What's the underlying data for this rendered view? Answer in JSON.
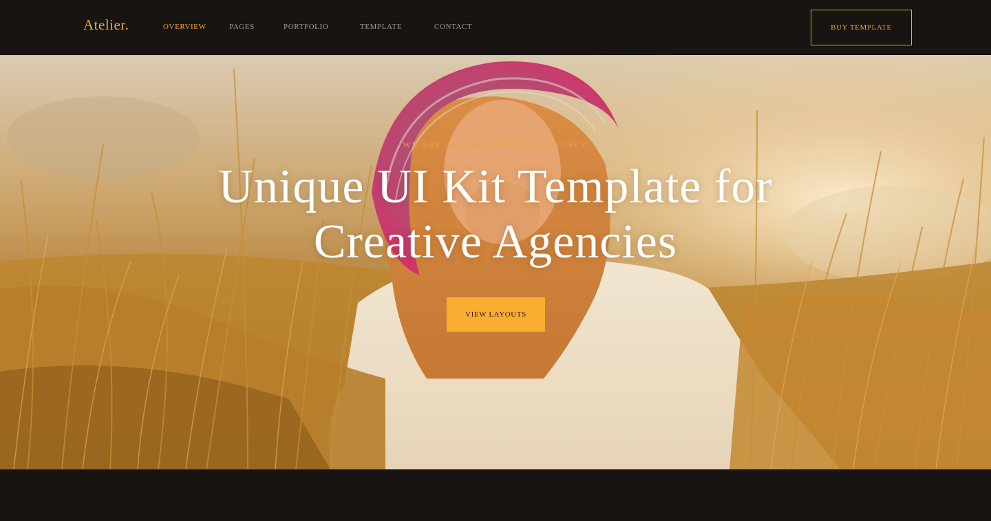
{
  "brand": {
    "logo": "Atelier."
  },
  "nav": {
    "items": [
      {
        "label": "OVERVIEW",
        "active": true
      },
      {
        "label": "PAGES",
        "active": false
      },
      {
        "label": "PORTFOLIO",
        "active": false
      },
      {
        "label": "TEMPLATE",
        "active": false
      },
      {
        "label": "CONTACT",
        "active": false
      }
    ],
    "cta_label": "BUY TEMPLATE"
  },
  "hero": {
    "eyebrow": "WE ARE ATELIER CREATIVE AGENCY",
    "headline_line1": "Unique UI Kit Template for",
    "headline_line2": "Creative Agencies",
    "cta_label": "VIEW LAYOUTS",
    "background_image": "woman-in-striped-hat-in-wheat-field"
  },
  "colors": {
    "accent": "#f0a93a",
    "cta_fill": "#f9ad31",
    "dark": "#171411",
    "nav_text": "#a29b92"
  }
}
